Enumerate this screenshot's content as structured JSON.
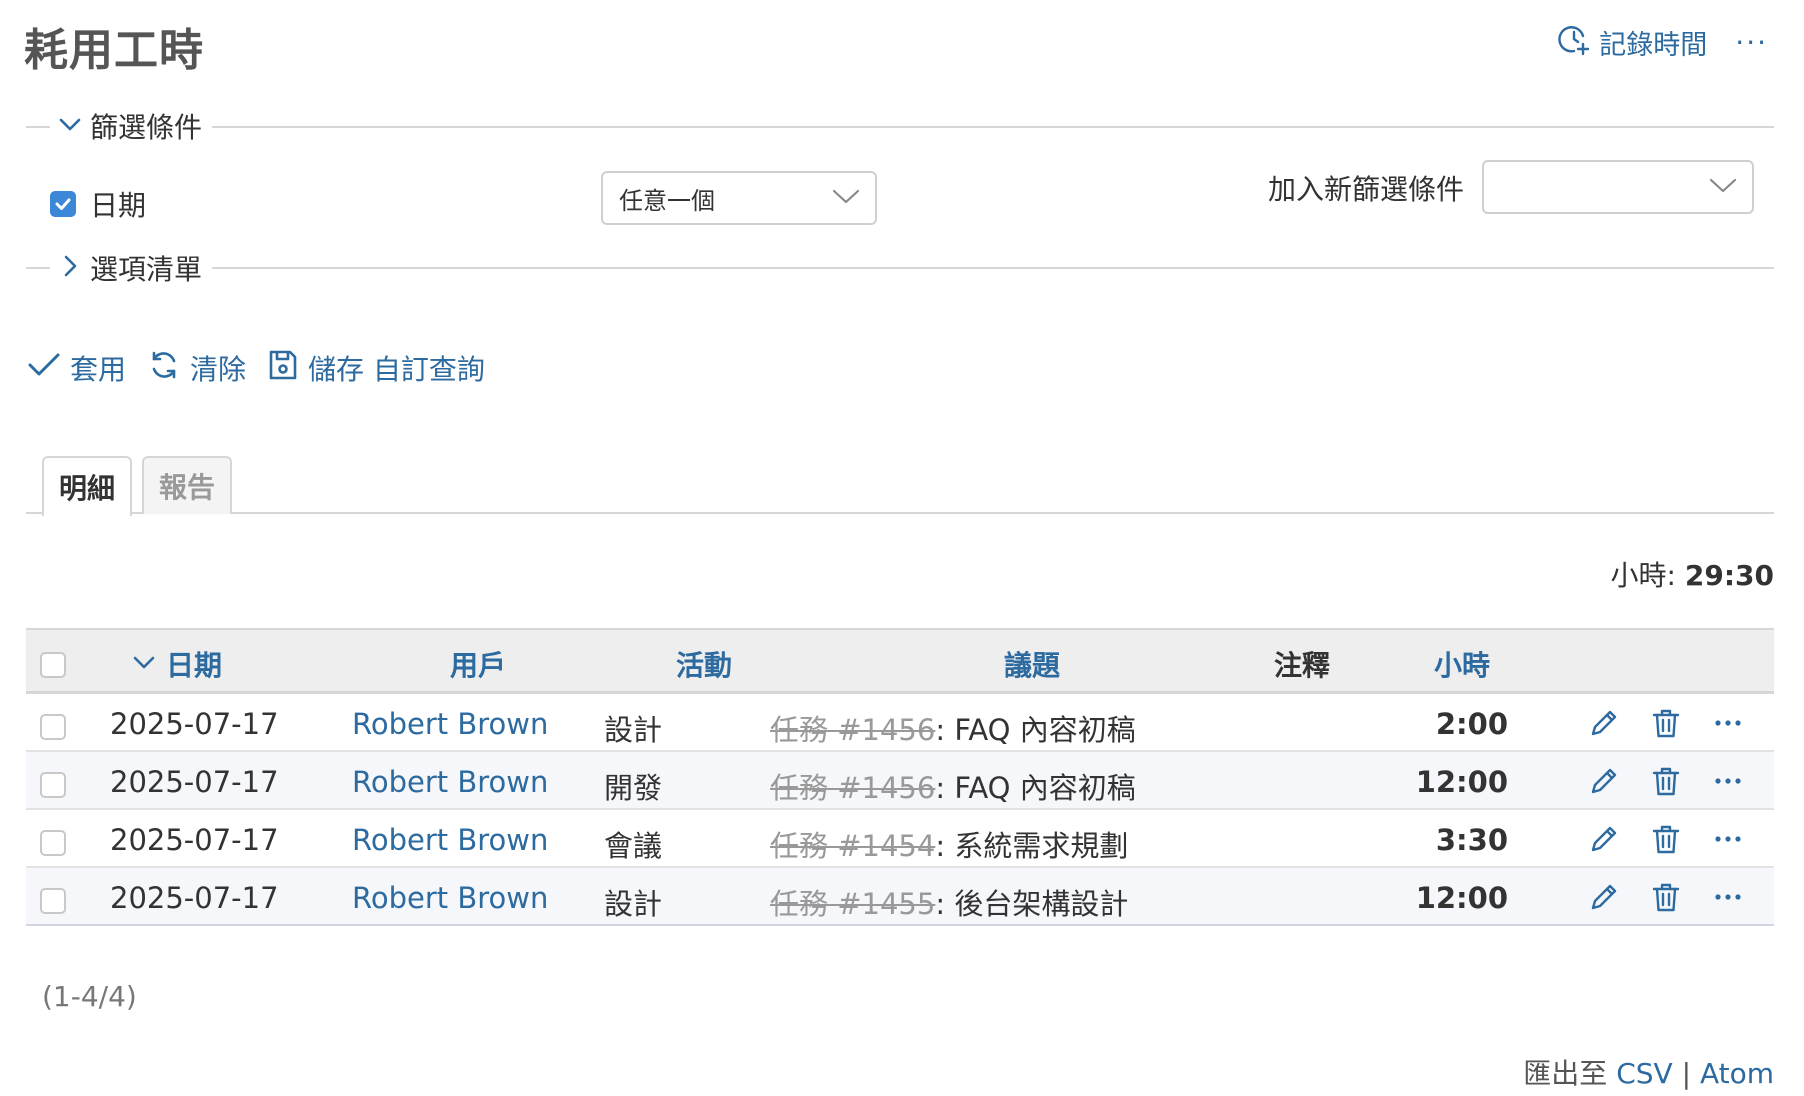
{
  "header": {
    "title": "耗用工時",
    "log_time_label": "記錄時間",
    "more_label": "···"
  },
  "filters": {
    "legend": "篩選條件",
    "date_label": "日期",
    "date_operator": "任意一個",
    "add_filter_label": "加入新篩選條件",
    "add_filter_value": ""
  },
  "options": {
    "legend": "選項清單"
  },
  "actions": {
    "apply": "套用",
    "clear": "清除",
    "save": "儲存 自訂查詢"
  },
  "tabs": [
    {
      "label": "明細",
      "active": true
    },
    {
      "label": "報告",
      "active": false
    }
  ],
  "totals": {
    "label": "小時:",
    "value": "29:30"
  },
  "table": {
    "columns": {
      "date": "日期",
      "user": "用戶",
      "activity": "活動",
      "issue": "議題",
      "comment": "注釋",
      "hours": "小時"
    },
    "rows": [
      {
        "date": "2025-07-17",
        "user": "Robert Brown",
        "activity": "設計",
        "issue_id": "任務 #1456",
        "issue_title": ": FAQ 內容初稿",
        "comment": "",
        "hours": "2:00"
      },
      {
        "date": "2025-07-17",
        "user": "Robert Brown",
        "activity": "開發",
        "issue_id": "任務 #1456",
        "issue_title": ": FAQ 內容初稿",
        "comment": "",
        "hours": "12:00"
      },
      {
        "date": "2025-07-17",
        "user": "Robert Brown",
        "activity": "會議",
        "issue_id": "任務 #1454",
        "issue_title": ": 系統需求規劃",
        "comment": "",
        "hours": "3:30"
      },
      {
        "date": "2025-07-17",
        "user": "Robert Brown",
        "activity": "設計",
        "issue_id": "任務 #1455",
        "issue_title": ": 後台架構設計",
        "comment": "",
        "hours": "12:00"
      }
    ]
  },
  "pagination": "(1-4/4)",
  "export": {
    "prefix": "匯出至",
    "csv": "CSV",
    "separator": "|",
    "atom": "Atom"
  },
  "colors": {
    "link": "#2c6aa0",
    "checkbox": "#3b87d8",
    "header_bg": "#eeeeee"
  }
}
